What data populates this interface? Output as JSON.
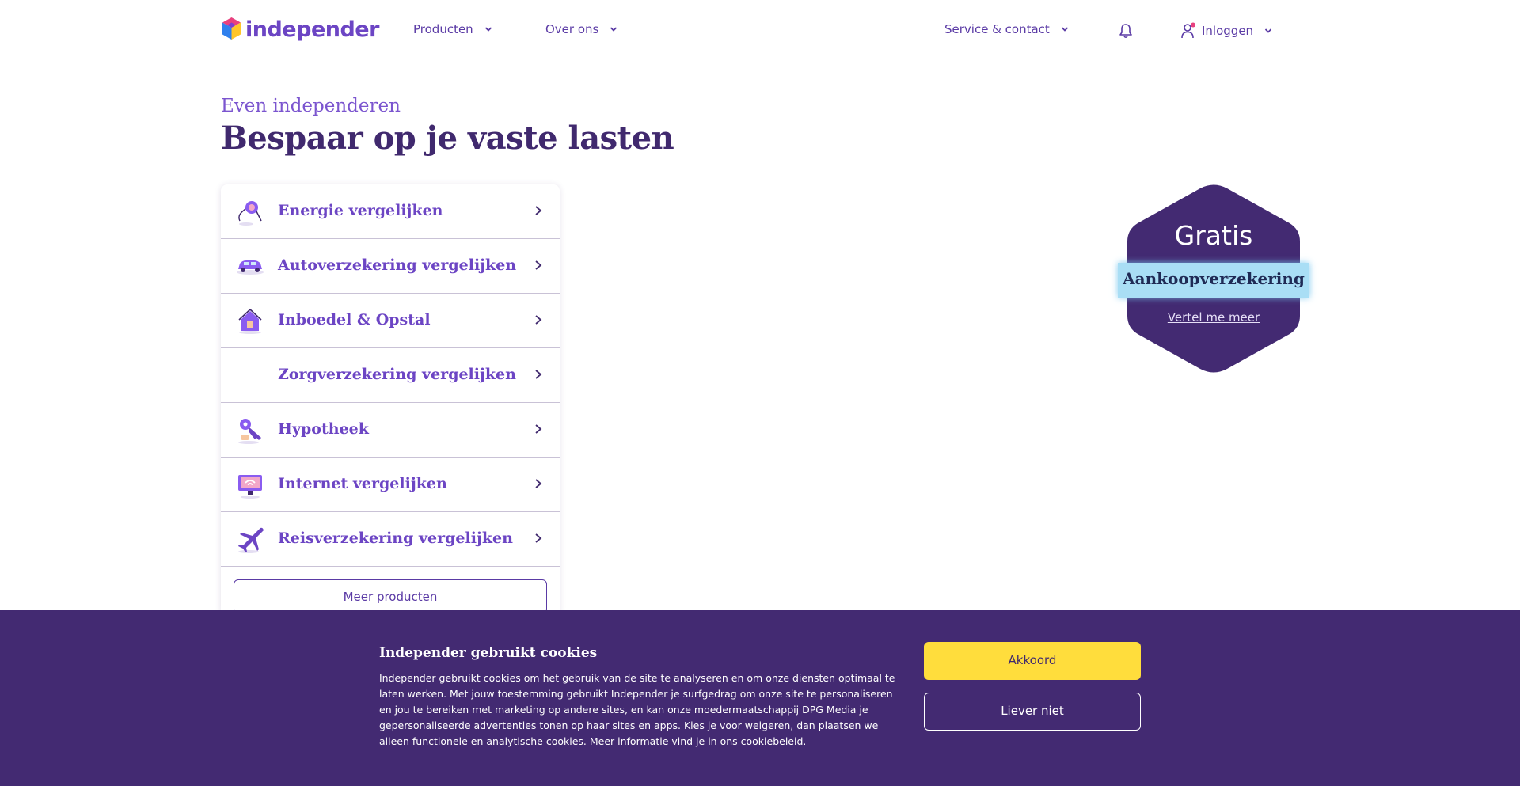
{
  "header": {
    "logo_text": "independer",
    "nav": [
      {
        "label": "Producten",
        "icon": "chevron-down-icon"
      },
      {
        "label": "Over ons",
        "icon": "chevron-down-icon"
      },
      {
        "label": "Service & contact",
        "icon": "chevron-down-icon"
      }
    ],
    "bell_icon": "bell-icon",
    "login_label": "Inloggen"
  },
  "hero": {
    "kicker": "Even independeren",
    "title": "Bespaar op je vaste lasten"
  },
  "products": {
    "items": [
      {
        "label": "Energie vergelijken",
        "icon": "energy-plug-icon"
      },
      {
        "label": "Autoverzekering vergelijken",
        "icon": "car-icon"
      },
      {
        "label": "Inboedel & Opstal",
        "icon": "house-icon"
      },
      {
        "label": "Zorgverzekering vergelijken",
        "icon": ""
      },
      {
        "label": "Hypotheek",
        "icon": "key-icon"
      },
      {
        "label": "Internet vergelijken",
        "icon": "monitor-wifi-icon"
      },
      {
        "label": "Reisverzekering vergelijken",
        "icon": "airplane-icon"
      }
    ],
    "more_label": "Meer producten"
  },
  "badge": {
    "title": "Gratis",
    "ribbon": "Aankoopverzekering",
    "link": "Vertel me meer"
  },
  "cookie": {
    "title": "Independer gebruikt cookies",
    "text": "Independer gebruikt cookies om het gebruik van de site te analyseren en om onze diensten optimaal te laten werken. Met jouw toestemming gebruikt Independer je surfgedrag om onze site te personaliseren en jou te bereiken met marketing op andere sites, en kan onze moedermaatschappij DPG Media je gepersonaliseerde advertenties tonen op haar sites en apps. Kies je voor weigeren, dan plaatsen we alleen functionele en analytische cookies. Meer informatie vind je in ons",
    "link": "cookiebeleid",
    "period": ".",
    "accept": "Akkoord",
    "decline": "Liever niet"
  },
  "colors": {
    "brand_purple": "#6c45c4",
    "dark_purple": "#40296e",
    "banner": "#432a72",
    "accept_yellow": "#ffdd3c",
    "ribbon_blue": "#a9def5"
  }
}
